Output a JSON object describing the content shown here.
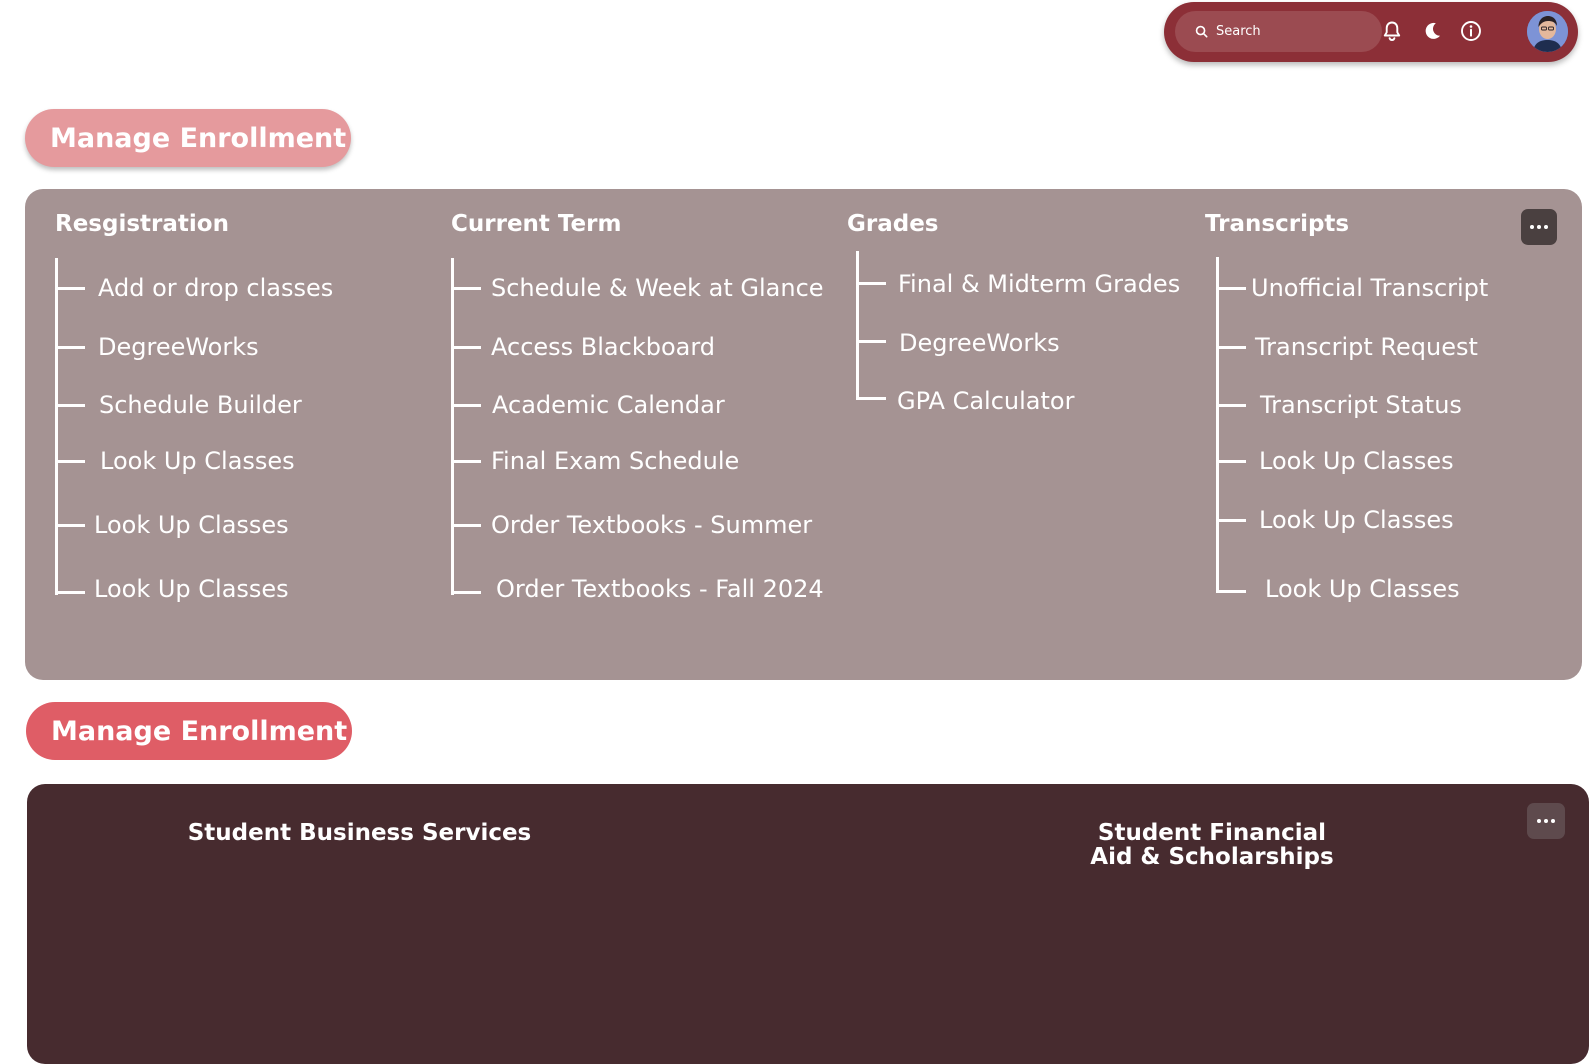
{
  "topbar": {
    "search_placeholder": "Search",
    "icons": [
      "search-icon",
      "bell-icon",
      "moon-icon",
      "info-icon",
      "avatar"
    ],
    "background": "#8c2f37"
  },
  "sections": [
    {
      "title": "Manage Enrollment",
      "pill_color": "#e59a9d",
      "panel_color": "#a59393",
      "columns": [
        {
          "title": "Resgistration",
          "items": [
            "Add or drop classes",
            "DegreeWorks",
            "Schedule Builder",
            "Look Up Classes",
            "Look Up Classes",
            "Look Up Classes"
          ]
        },
        {
          "title": "Current Term",
          "items": [
            "Schedule & Week at Glance",
            "Access Blackboard",
            "Academic Calendar",
            "Final Exam Schedule",
            "Order Textbooks - Summer",
            "Order Textbooks - Fall 2024"
          ]
        },
        {
          "title": "Grades",
          "items": [
            "Final & Midterm Grades",
            "DegreeWorks",
            "GPA Calculator"
          ]
        },
        {
          "title": "Transcripts",
          "items": [
            "Unofficial Transcript",
            "Transcript Request",
            "Transcript Status",
            "Look Up Classes",
            "Look Up Classes",
            "Look Up Classes"
          ]
        }
      ]
    },
    {
      "title": "Manage Enrollment",
      "pill_color": "#df5d66",
      "panel_color": "#472b2f",
      "columns": [
        {
          "title": "Student Business Services"
        },
        {
          "title_line1": "Student Financial",
          "title_line2": "Aid & Scholarships"
        }
      ]
    }
  ]
}
